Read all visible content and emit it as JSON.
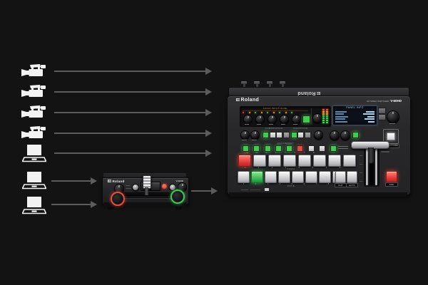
{
  "canvas": {
    "background": "#131313",
    "arrow_color": "#5c5c5c"
  },
  "sources": {
    "items": [
      {
        "type": "video-camera"
      },
      {
        "type": "video-camera"
      },
      {
        "type": "video-camera"
      },
      {
        "type": "video-camera"
      },
      {
        "type": "laptop"
      },
      {
        "type": "laptop"
      },
      {
        "type": "laptop"
      }
    ]
  },
  "small_switcher": {
    "brand": "Roland",
    "model": "V-02HD"
  },
  "large_switcher": {
    "brand": "Roland",
    "brand_back": "Roland",
    "tagline": "HD VIDEO SWITCHER",
    "model": "V-60HD",
    "lcd_title": "PANEL INFO",
    "audio_section": "AUDIO INPUT LEVEL",
    "composition_section": "COMPOSITION",
    "transition_section": "TRANSITION",
    "aux_section": "AUX/MEMORY",
    "bus_a_label": "PGM/A",
    "bus_b_label": "PST/B",
    "crosspoint_numbers": [
      "1",
      "2",
      "3",
      "4",
      "5",
      "6",
      "7",
      "8"
    ],
    "cut_label": "CUT",
    "auto_label": "AUTO",
    "dsk_label": "DSK",
    "output_fade_label": "OUTPUT FADE"
  },
  "status_colors": {
    "lit_red": "#e03434",
    "lit_green": "#35b54e",
    "meter_amber": "#ffa020",
    "lcd_text": "#a9d2ef"
  }
}
